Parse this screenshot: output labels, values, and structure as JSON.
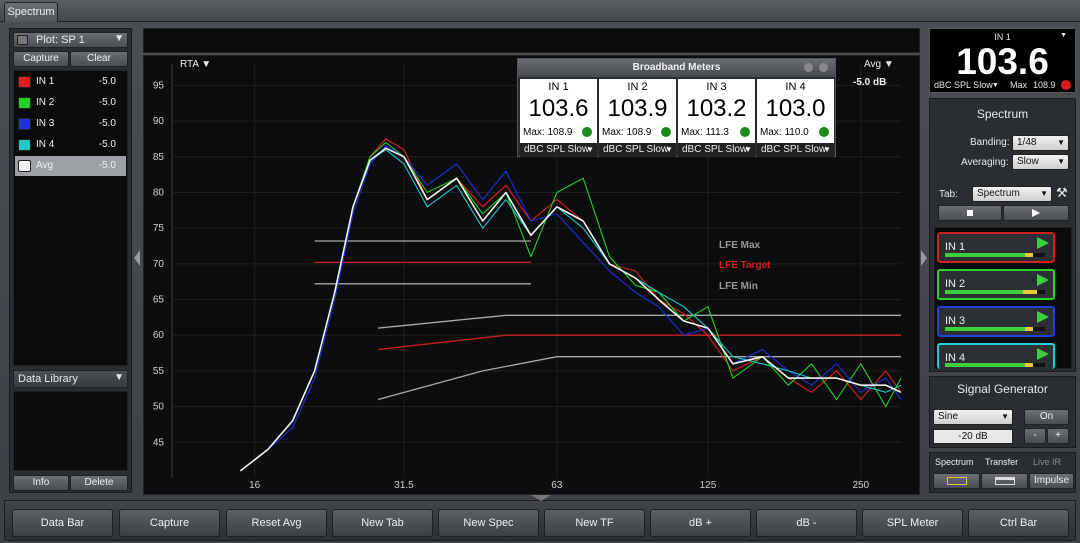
{
  "window": {
    "tab_label": "Spectrum"
  },
  "left": {
    "plot_label": "Plot: SP 1",
    "capture_label": "Capture",
    "clear_label": "Clear",
    "traces": [
      {
        "name": "IN 1",
        "value": "-5.0",
        "color": "#e02020",
        "selected": false
      },
      {
        "name": "IN 2",
        "value": "-5.0",
        "color": "#25d025",
        "selected": false
      },
      {
        "name": "IN 3",
        "value": "-5.0",
        "color": "#2030e0",
        "selected": false
      },
      {
        "name": "IN 4",
        "value": "-5.0",
        "color": "#20c8c8",
        "selected": false
      },
      {
        "name": "Avg",
        "value": "-5.0",
        "color": "#f0f0f0",
        "selected": true
      }
    ],
    "data_library_label": "Data Library",
    "info_label": "Info",
    "delete_label": "Delete"
  },
  "plot": {
    "mode_label": "RTA ▼",
    "avg_label": "Avg ▼",
    "avg_value": "-5.0 dB",
    "lfe_max_label": "LFE Max",
    "lfe_target_label": "LFE Target",
    "lfe_min_label": "LFE Min"
  },
  "broadband": {
    "title": "Broadband Meters",
    "meters": [
      {
        "name": "IN 1",
        "value": "103.6",
        "max": "Max: 108.9",
        "mode": "dBC SPL Slow"
      },
      {
        "name": "IN 2",
        "value": "103.9",
        "max": "Max: 108.9",
        "mode": "dBC SPL Slow"
      },
      {
        "name": "IN 3",
        "value": "103.2",
        "max": "Max: 111.3",
        "mode": "dBC SPL Slow"
      },
      {
        "name": "IN 4",
        "value": "103.0",
        "max": "Max: 110.0",
        "mode": "dBC SPL Slow"
      }
    ]
  },
  "right": {
    "meter_channel": "IN 1",
    "meter_value": "103.6",
    "meter_mode": "dBC SPL Slow",
    "meter_max_label": "Max",
    "meter_max_value": "108.9",
    "spectrum_title": "Spectrum",
    "banding_label": "Banding:",
    "banding_value": "1/48",
    "averaging_label": "Averaging:",
    "averaging_value": "Slow",
    "tab_label": "Tab:",
    "tab_value": "Spectrum",
    "inputs": [
      {
        "name": "IN 1",
        "color": "#d02020"
      },
      {
        "name": "IN 2",
        "color": "#30d030"
      },
      {
        "name": "IN 3",
        "color": "#2040e0"
      },
      {
        "name": "IN 4",
        "color": "#20d0d0"
      }
    ],
    "signal_title": "Signal Generator",
    "signal_type": "Sine",
    "signal_on": "On",
    "signal_level": "-20 dB",
    "signal_minus": "-",
    "signal_plus": "+",
    "tabs": [
      "Spectrum",
      "Transfer",
      "Live IR"
    ],
    "impulse_label": "Impulse"
  },
  "bottom_buttons": [
    "Data Bar",
    "Capture",
    "Reset Avg",
    "New Tab",
    "New Spec",
    "New TF",
    "dB +",
    "dB -",
    "SPL Meter",
    "Ctrl Bar"
  ],
  "chart_data": {
    "type": "line",
    "x_scale": "log",
    "xlabel": "",
    "ylabel": "",
    "xlim": [
      11,
      300
    ],
    "ylim": [
      40,
      98
    ],
    "x_ticks": [
      16,
      31.5,
      63,
      125,
      250
    ],
    "x_tick_labels": [
      "16",
      "31.5",
      "63",
      "125",
      "250"
    ],
    "y_ticks": [
      45,
      50,
      55,
      60,
      65,
      70,
      75,
      80,
      85,
      90,
      95
    ],
    "series": [
      {
        "name": "IN 1",
        "color": "#e02020",
        "x": [
          15,
          17,
          19,
          21,
          23,
          25,
          27,
          29,
          31.5,
          35,
          40,
          45,
          50,
          56,
          63,
          71,
          80,
          90,
          100,
          112,
          125,
          140,
          160,
          180,
          200,
          224,
          250,
          280,
          300
        ],
        "y": [
          41,
          44,
          48,
          55,
          66,
          78,
          85,
          87.5,
          86,
          79,
          82,
          78,
          81,
          76,
          79,
          76,
          70,
          69,
          65,
          63,
          60,
          55,
          57,
          54,
          52,
          55,
          51,
          55,
          52
        ]
      },
      {
        "name": "IN 2",
        "color": "#25d025",
        "x": [
          15,
          17,
          19,
          21,
          23,
          25,
          27,
          29,
          31.5,
          35,
          40,
          45,
          50,
          56,
          63,
          71,
          80,
          90,
          100,
          112,
          125,
          140,
          160,
          180,
          200,
          224,
          250,
          280,
          300
        ],
        "y": [
          41,
          44,
          48,
          55,
          66,
          78,
          85,
          87,
          85,
          80,
          82,
          77,
          80,
          71,
          80,
          82,
          71,
          67,
          66,
          62,
          64,
          54,
          57,
          53,
          56,
          51,
          56,
          50,
          54
        ]
      },
      {
        "name": "IN 3",
        "color": "#2030e0",
        "x": [
          15,
          17,
          19,
          21,
          23,
          25,
          27,
          29,
          31.5,
          35,
          40,
          45,
          50,
          56,
          63,
          71,
          80,
          90,
          100,
          112,
          125,
          140,
          160,
          180,
          200,
          224,
          250,
          280,
          300
        ],
        "y": [
          41,
          44,
          47,
          54,
          65,
          77,
          84,
          86.5,
          85,
          81,
          84,
          79,
          83,
          76,
          77,
          73,
          69,
          66,
          64,
          60,
          61,
          56,
          58,
          55,
          53,
          56,
          52,
          54,
          51
        ]
      },
      {
        "name": "IN 4",
        "color": "#20c8c8",
        "x": [
          15,
          17,
          19,
          21,
          23,
          25,
          27,
          29,
          31.5,
          35,
          40,
          45,
          50,
          56,
          63,
          71,
          80,
          90,
          100,
          112,
          125,
          140,
          160,
          180,
          200,
          224,
          250,
          280,
          300
        ],
        "y": [
          41,
          44,
          48,
          55,
          66,
          78,
          84.5,
          86,
          84,
          78,
          81,
          75,
          79,
          74,
          78,
          75,
          70,
          68,
          66,
          64,
          61,
          57,
          56,
          55,
          54,
          54,
          53,
          52,
          53
        ]
      },
      {
        "name": "Avg",
        "color": "#f2f2f2",
        "x": [
          15,
          17,
          19,
          21,
          23,
          25,
          27,
          29,
          31.5,
          35,
          40,
          45,
          50,
          56,
          63,
          71,
          80,
          90,
          100,
          112,
          125,
          140,
          160,
          180,
          200,
          224,
          250,
          280,
          300
        ],
        "y": [
          41,
          44,
          48,
          55,
          66,
          78,
          84.5,
          86.2,
          85,
          79,
          82,
          76,
          80,
          74,
          78,
          76,
          70,
          68,
          65,
          62,
          61,
          56,
          57,
          54,
          54,
          54,
          53,
          53,
          52
        ]
      }
    ],
    "reference_lines": [
      {
        "label": "LFE Max",
        "color": "#a8a8a8",
        "x": [
          21,
          56
        ],
        "y": [
          73.2,
          73.2
        ]
      },
      {
        "label": "LFE Target",
        "color": "#c82020",
        "x": [
          21,
          56
        ],
        "y": [
          70.2,
          70.2
        ]
      },
      {
        "label": "LFE Min",
        "color": "#a8a8a8",
        "x": [
          21,
          56
        ],
        "y": [
          67.2,
          67.2
        ]
      },
      {
        "label": "",
        "color": "#a8a8a8",
        "x": [
          28,
          50,
          63,
          125,
          300
        ],
        "y": [
          61,
          62.8,
          62.8,
          62.8,
          62.8
        ]
      },
      {
        "label": "",
        "color": "#c82020",
        "x": [
          28,
          50,
          63,
          125,
          300
        ],
        "y": [
          58,
          60,
          60,
          60,
          60
        ]
      },
      {
        "label": "",
        "color": "#a8a8a8",
        "x": [
          28,
          45,
          63,
          125,
          300
        ],
        "y": [
          51,
          55,
          57,
          57,
          57
        ]
      }
    ]
  }
}
